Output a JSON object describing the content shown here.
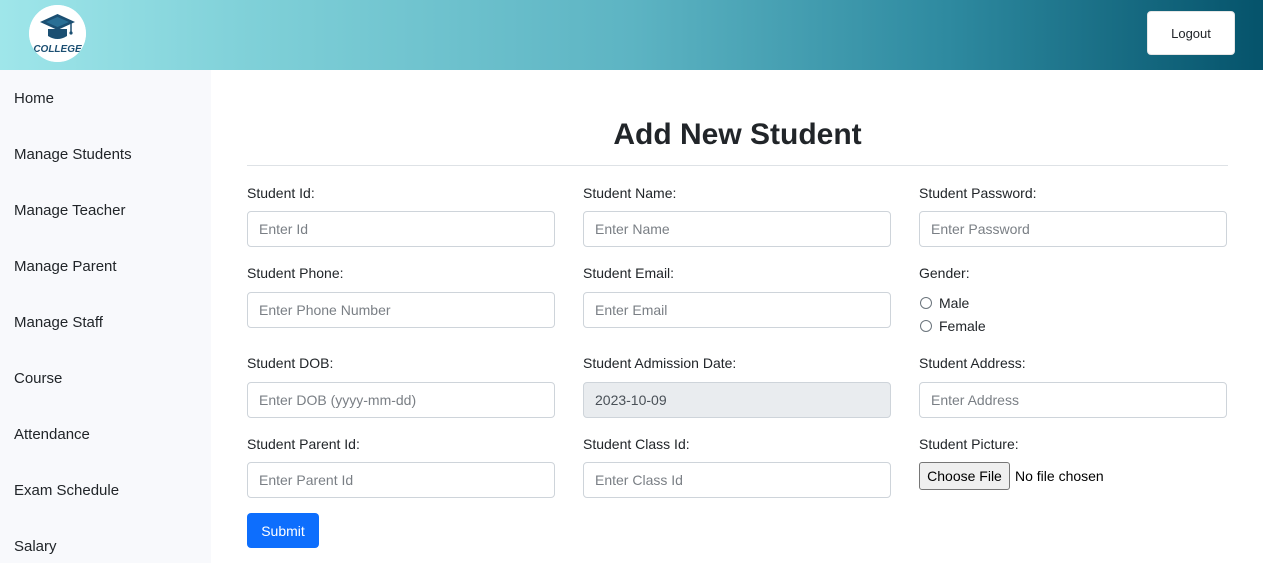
{
  "header": {
    "logo_text": "COLLEGE",
    "logout_label": "Logout"
  },
  "sidebar": {
    "items": [
      {
        "label": "Home"
      },
      {
        "label": "Manage Students"
      },
      {
        "label": "Manage Teacher"
      },
      {
        "label": "Manage Parent"
      },
      {
        "label": "Manage Staff"
      },
      {
        "label": "Course"
      },
      {
        "label": "Attendance"
      },
      {
        "label": "Exam Schedule"
      },
      {
        "label": "Salary"
      }
    ]
  },
  "form": {
    "title": "Add New Student",
    "student_id": {
      "label": "Student Id:",
      "placeholder": "Enter Id"
    },
    "student_name": {
      "label": "Student Name:",
      "placeholder": "Enter Name"
    },
    "student_password": {
      "label": "Student Password:",
      "placeholder": "Enter Password"
    },
    "student_phone": {
      "label": "Student Phone:",
      "placeholder": "Enter Phone Number"
    },
    "student_email": {
      "label": "Student Email:",
      "placeholder": "Enter Email"
    },
    "gender": {
      "label": "Gender:",
      "options": [
        "Male",
        "Female"
      ]
    },
    "student_dob": {
      "label": "Student DOB:",
      "placeholder": "Enter DOB (yyyy-mm-dd)"
    },
    "admission_date": {
      "label": "Student Admission Date:",
      "value": "2023-10-09"
    },
    "student_address": {
      "label": "Student Address:",
      "placeholder": "Enter Address"
    },
    "parent_id": {
      "label": "Student Parent Id:",
      "placeholder": "Enter Parent Id"
    },
    "class_id": {
      "label": "Student Class Id:",
      "placeholder": "Enter Class Id"
    },
    "picture": {
      "label": "Student Picture:",
      "button_label": "Choose File",
      "status": "No file chosen"
    },
    "submit_label": "Submit"
  },
  "colors": {
    "primary": "#0d6efd",
    "header_gradient_start": "#9fe6ea",
    "header_gradient_end": "#05536b",
    "logo_navy": "#1b4f72"
  }
}
